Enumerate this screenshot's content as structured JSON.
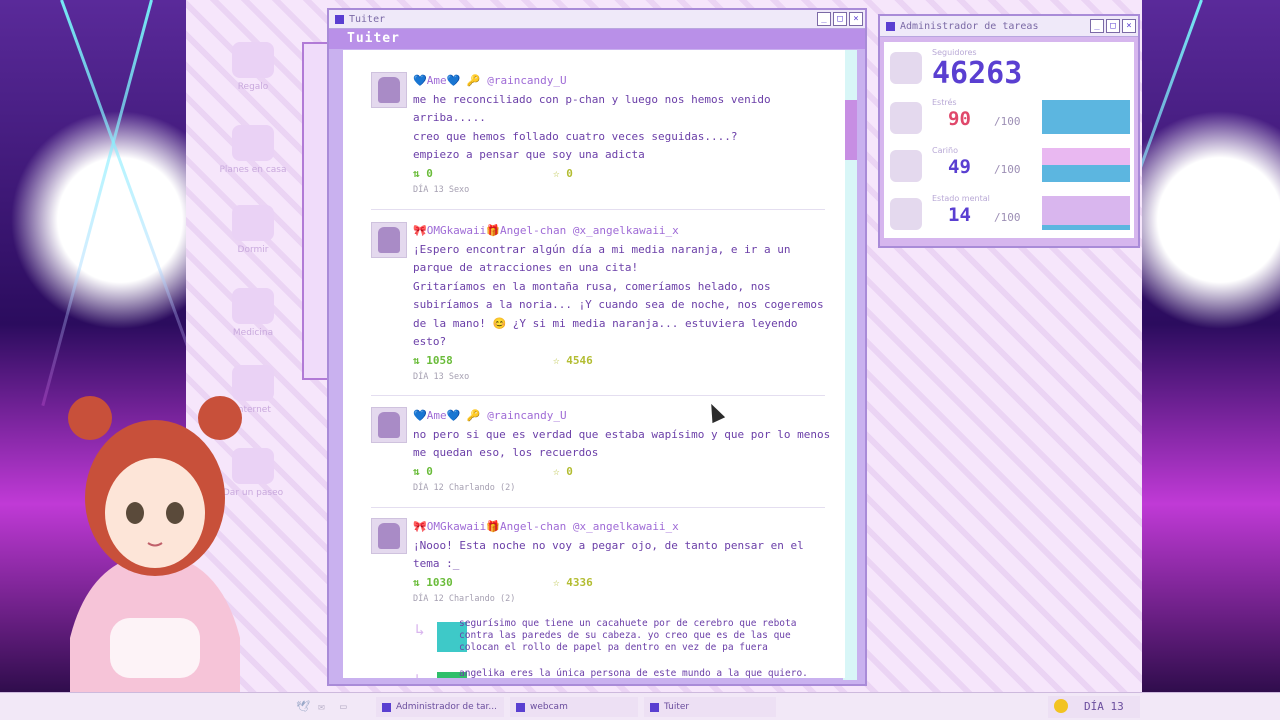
{
  "desktop": {
    "icons": [
      {
        "label": "Regalo",
        "icon": "gift-icon"
      },
      {
        "label": "Planes en casa",
        "icon": "house-icon"
      },
      {
        "label": "Dormir",
        "icon": "bed-icon"
      },
      {
        "label": "Medicina",
        "icon": "pill-icon"
      },
      {
        "label": "Internet",
        "icon": "globe-icon"
      },
      {
        "label": "Dar un paseo",
        "icon": "walk-icon"
      }
    ]
  },
  "tuiter": {
    "window_title": "Tuiter",
    "header": "Tuiter",
    "posts": [
      {
        "user": "💙Ame💙 🔑 @raincandy_U",
        "text": "me he reconciliado con p-chan y luego nos hemos venido\narriba.....\ncreo que hemos follado cuatro veces seguidas....?\nempiezo a pensar que soy una adicta",
        "retweets": "0",
        "favs": "0",
        "date": "DÍA 13 Sexo"
      },
      {
        "user": "🎀OMGkawaii🎁Angel-chan @x_angelkawaii_x",
        "text": "¡Espero encontrar algún día a mi media naranja, e ir a un\nparque de atracciones en una cita!\nGritaríamos en la montaña rusa, comeríamos helado, nos\nsubiríamos a la noria... ¡Y cuando sea de noche, nos cogeremos\nde la mano! 😊 ¿Y si mi media naranja... estuviera leyendo\nesto?",
        "retweets": "1058",
        "favs": "4546",
        "date": "DÍA 13 Sexo"
      },
      {
        "user": "💙Ame💙 🔑 @raincandy_U",
        "text": "no pero si que es verdad que estaba wapísimo y que por lo menos\nme quedan eso, los recuerdos",
        "retweets": "0",
        "favs": "0",
        "date": "DÍA 12 Charlando (2)"
      },
      {
        "user": "🎀OMGkawaii🎁Angel-chan @x_angelkawaii_x",
        "text": "¡Nooo! Esta noche no voy a pegar ojo, de tanto pensar en el\ntema :_",
        "retweets": "1030",
        "favs": "4336",
        "date": "DÍA 12 Charlando (2)"
      }
    ],
    "replies": [
      {
        "text": "segurísimo que tiene un cacahuete por de cerebro que rebota\ncontra las paredes de su cabeza. yo creo que es de las que\ncolocan el rollo de papel pa dentro en vez de pa fuera"
      },
      {
        "text": "angelika eres la única persona de este mundo a la que quiero."
      }
    ]
  },
  "task_manager": {
    "window_title": "Administrador de tareas",
    "followers": {
      "label": "Seguidores",
      "value": "46263"
    },
    "stats": [
      {
        "label": "Estrés",
        "value": "90",
        "max": "/100",
        "color": "#e0486b",
        "bar_color": "#5cb6e0"
      },
      {
        "label": "Cariño",
        "value": "49",
        "max": "/100",
        "color": "#5a3fd1",
        "bar_color": "#e9b8f1"
      },
      {
        "label": "Estado mental",
        "value": "14",
        "max": "/100",
        "color": "#5a3fd1",
        "bar_color": "#d9b6ee"
      }
    ]
  },
  "taskbar": {
    "items": [
      {
        "label": "Administrador de tar..."
      },
      {
        "label": "webcam"
      },
      {
        "label": "Tuiter"
      }
    ],
    "day": "DÍA 13"
  }
}
